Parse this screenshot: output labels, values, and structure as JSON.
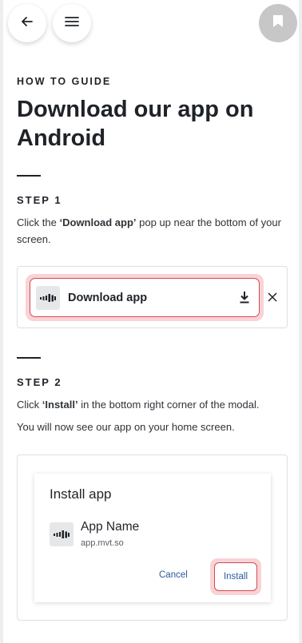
{
  "header": {
    "back_icon": "arrow-left-icon",
    "menu_icon": "hamburger-menu-icon",
    "bookmark_icon": "bookmark-icon"
  },
  "guide": {
    "eyebrow": "HOW TO GUIDE",
    "title": "Download our app on Android"
  },
  "step1": {
    "label": "STEP 1",
    "text_before": "Click the ",
    "text_bold": "‘Download app’",
    "text_after": " pop up near the bottom of your screen.",
    "banner": {
      "label": "Download app",
      "download_icon": "download-icon",
      "close_icon": "close-icon"
    }
  },
  "step2": {
    "label": "STEP 2",
    "text_before": "Click ",
    "text_bold": "‘Install’",
    "text_after": " in the bottom right corner of the modal.",
    "text2": "You will now see our app on your home screen.",
    "modal": {
      "title": "Install app",
      "app_name": "App Name",
      "app_url": "app.mvt.so",
      "cancel_label": "Cancel",
      "install_label": "Install"
    }
  },
  "colors": {
    "highlight_border": "#d24b55",
    "highlight_glow": "#f9d3d6",
    "link_blue": "#2b5c9c",
    "text_dark": "#1f2328"
  }
}
